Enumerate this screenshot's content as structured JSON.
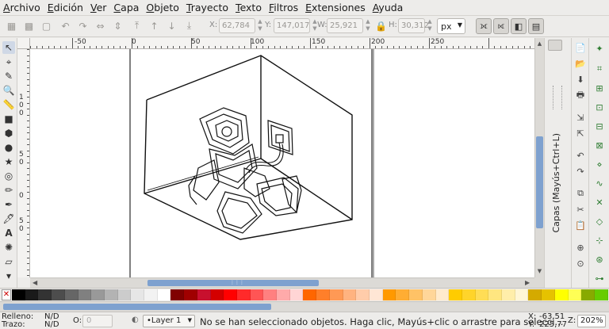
{
  "menu": [
    "Archivo",
    "Edición",
    "Ver",
    "Capa",
    "Objeto",
    "Trayecto",
    "Texto",
    "Filtros",
    "Extensiones",
    "Ayuda"
  ],
  "toolbar": {
    "x_label": "X:",
    "x_value": "62,784",
    "y_label": "Y:",
    "y_value": "147,017",
    "w_label": "W:",
    "w_value": "25,921",
    "h_label": "H:",
    "h_value": "30,312",
    "unit": "px"
  },
  "rulers": {
    "top": [
      "-50",
      "0",
      "50",
      "100",
      "150",
      "200",
      "250"
    ],
    "left": [
      "1",
      "0",
      "0",
      "5",
      "0",
      "0",
      "5",
      "0"
    ]
  },
  "layers_dock": {
    "title": "Capas (Mayús+Ctrl+L)"
  },
  "palette": {
    "colors": [
      "#000000",
      "#1a1a1a",
      "#333333",
      "#4d4d4d",
      "#666666",
      "#808080",
      "#999999",
      "#b3b3b3",
      "#cccccc",
      "#e6e6e6",
      "#f2f2f2",
      "#ffffff",
      "#800000",
      "#a00000",
      "#c8102e",
      "#d40000",
      "#ff0000",
      "#ff2a2a",
      "#ff5555",
      "#ff8080",
      "#ffaaaa",
      "#ffd5d5",
      "#ff6600",
      "#ff7f2a",
      "#ff9955",
      "#ffb380",
      "#ffccaa",
      "#ffe6d5",
      "#ff9900",
      "#ffad33",
      "#ffc266",
      "#ffd699",
      "#ffeacc",
      "#ffcc00",
      "#ffd42a",
      "#ffdd55",
      "#ffe680",
      "#ffeeaa",
      "#fff6d5",
      "#d4aa00",
      "#e6c200",
      "#ffff00",
      "#ffff55",
      "#88aa00",
      "#66cc00"
    ]
  },
  "status": {
    "fill_label": "Relleno:",
    "fill_value": "N/D",
    "stroke_label": "Trazo:",
    "stroke_value": "N/D",
    "opacity_label": "O:",
    "opacity_value": "0",
    "layer": "•Layer 1",
    "message": "No se han seleccionado objetos. Haga clic, Mayús+clic o arrastre para selecci...",
    "x_label": "X:",
    "x_coord": "-63,51",
    "y_label": "Y:",
    "y_coord": "225,77",
    "zoom_label": "Z:",
    "zoom": "202%"
  }
}
